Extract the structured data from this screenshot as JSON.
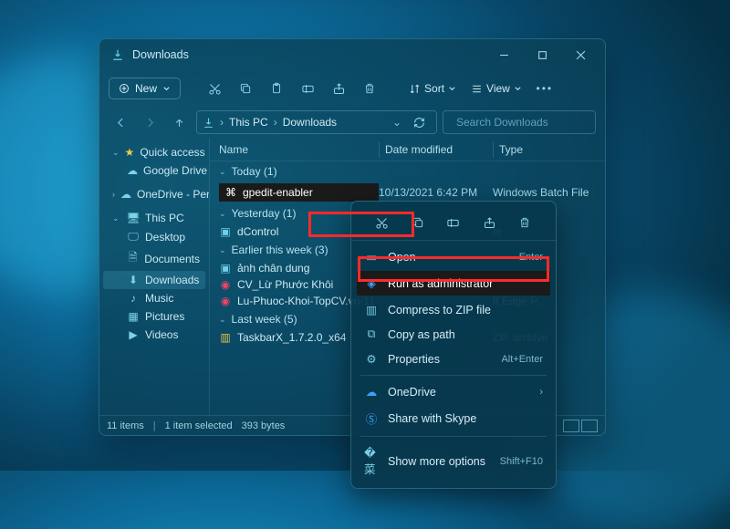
{
  "window": {
    "title": "Downloads"
  },
  "toolbar": {
    "new_label": "New",
    "sort_label": "Sort",
    "view_label": "View"
  },
  "breadcrumb": {
    "seg1": "This PC",
    "seg2": "Downloads"
  },
  "search": {
    "placeholder": "Search Downloads"
  },
  "nav": {
    "quick": "Quick access",
    "gdrive": "Google Drive",
    "onedrive": "OneDrive - Perso",
    "thispc": "This PC",
    "desktop": "Desktop",
    "documents": "Documents",
    "downloads": "Downloads",
    "music": "Music",
    "pictures": "Pictures",
    "videos": "Videos"
  },
  "columns": {
    "name": "Name",
    "date": "Date modified",
    "type": "Type"
  },
  "groups": {
    "g0": "Today (1)",
    "g1": "Yesterday (1)",
    "g2": "Earlier this week (3)",
    "g3": "Last week (5)"
  },
  "files": {
    "f0": {
      "name": "gpedit-enabler",
      "date": "10/13/2021 6:42 PM",
      "type": "Windows Batch File"
    },
    "f1": {
      "name": "dControl",
      "date": "",
      "type": "er"
    },
    "f2": {
      "name": "ảnh chân dung",
      "date": "",
      "type": ""
    },
    "f3": {
      "name": "CV_Lừ Phước Khôi",
      "date": "",
      "type": "ft Edge P..."
    },
    "f4": {
      "name": "Lu-Phuoc-Khoi-TopCV.vn-11",
      "date": "",
      "type": "ft Edge P..."
    },
    "f5": {
      "name": "TaskbarX_1.7.2.0_x64",
      "date": "",
      "type": "ZIP archive"
    }
  },
  "ctx": {
    "open": "Open",
    "open_sc": "Enter",
    "runadmin": "Run as administrator",
    "compress": "Compress to ZIP file",
    "copypath": "Copy as path",
    "props": "Properties",
    "props_sc": "Alt+Enter",
    "onedrive": "OneDrive",
    "skype": "Share with Skype",
    "more": "Show more options",
    "more_sc": "Shift+F10"
  },
  "status": {
    "count": "11 items",
    "selected": "1 item selected",
    "size": "393 bytes"
  }
}
